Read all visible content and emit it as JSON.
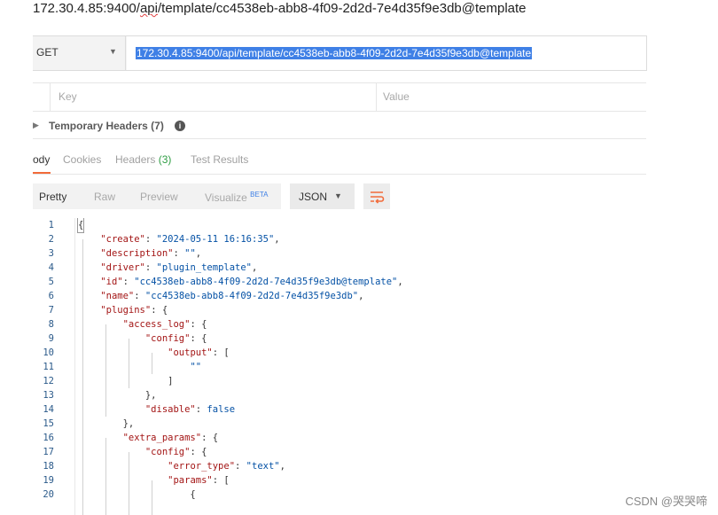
{
  "heading": {
    "pre": "172.30.4.85:9400/",
    "squiggle": "api",
    "post": "/template/cc4538eb-abb8-4f09-2d2d-7e4d35f9e3db@template"
  },
  "request": {
    "method": "GET",
    "url": "172.30.4.85:9400/api/template/cc4538eb-abb8-4f09-2d2d-7e4d35f9e3db@template"
  },
  "params": {
    "key_header": "Key",
    "value_header": "Value"
  },
  "temp_headers": {
    "label": "Temporary Headers (7)",
    "info_icon": "info-icon"
  },
  "response_tabs": [
    {
      "label": "ody",
      "active": true
    },
    {
      "label": "Cookies"
    },
    {
      "label": "Headers",
      "count": "(3)"
    },
    {
      "label": "Test Results"
    }
  ],
  "view_tabs": {
    "pretty": "Pretty",
    "raw": "Raw",
    "preview": "Preview",
    "visualize": "Visualize",
    "beta": "BETA"
  },
  "format": {
    "selected": "JSON"
  },
  "wrap_icon": "wrap-lines-icon",
  "code_lines": [
    "1",
    "2",
    "3",
    "4",
    "5",
    "6",
    "7",
    "8",
    "9",
    "10",
    "11",
    "12",
    "13",
    "14",
    "15",
    "16",
    "17",
    "18",
    "19",
    "20"
  ],
  "json": {
    "create_key": "\"create\"",
    "create_val": "\"2024-05-11 16:16:35\"",
    "desc_key": "\"description\"",
    "desc_val": "\"\"",
    "driver_key": "\"driver\"",
    "driver_val": "\"plugin_template\"",
    "id_key": "\"id\"",
    "id_val": "\"cc4538eb-abb8-4f09-2d2d-7e4d35f9e3db@template\"",
    "name_key": "\"name\"",
    "name_val": "\"cc4538eb-abb8-4f09-2d2d-7e4d35f9e3db\"",
    "plugins_key": "\"plugins\"",
    "access_log_key": "\"access_log\"",
    "config_key": "\"config\"",
    "output_key": "\"output\"",
    "empty_str": "\"\"",
    "disable_key": "\"disable\"",
    "disable_val": "false",
    "extra_params_key": "\"extra_params\"",
    "error_type_key": "\"error_type\"",
    "error_type_val": "\"text\"",
    "params_key": "\"params\""
  },
  "watermark": "CSDN @哭哭啼"
}
